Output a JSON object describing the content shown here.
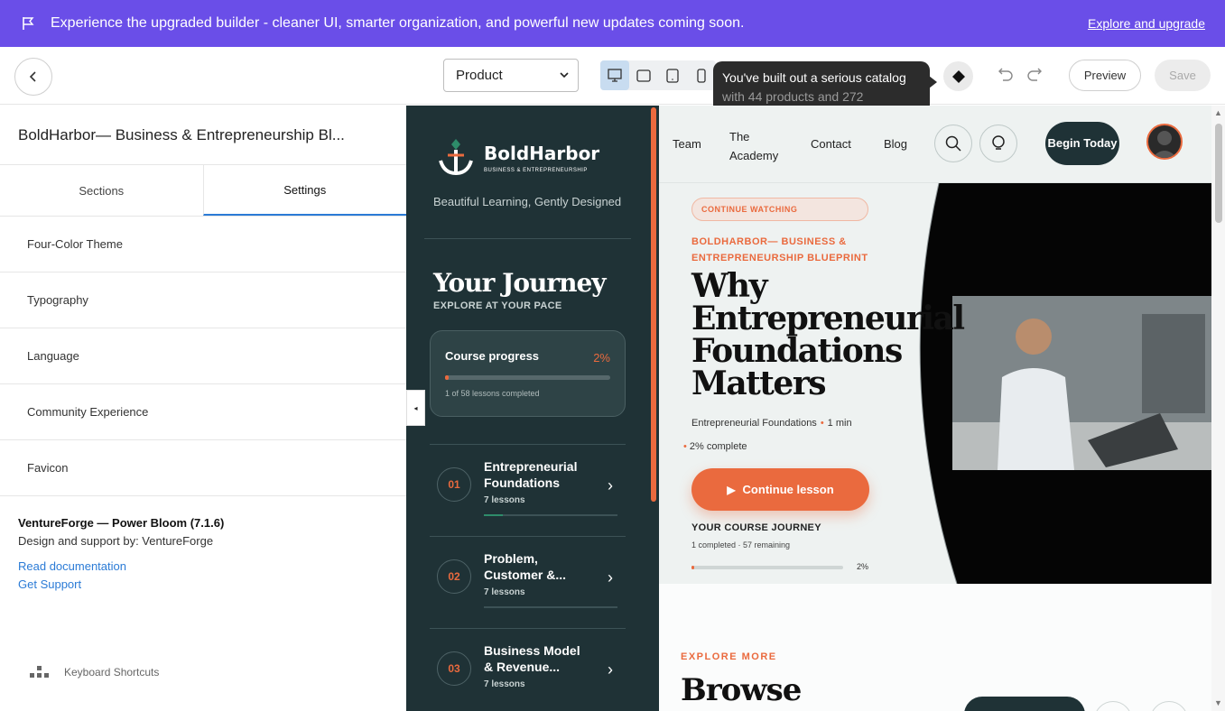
{
  "banner": {
    "message": "Experience the upgraded builder - cleaner UI, smarter organization, and powerful new updates coming soon.",
    "link": "Explore and upgrade",
    "color": "#6a4ee8"
  },
  "toolbar": {
    "page_select": "Product",
    "devices": [
      "desktop-icon",
      "tablet-landscape-icon",
      "tablet-portrait-icon",
      "mobile-icon"
    ],
    "tooltip_line1": "You've built out a serious catalog",
    "tooltip_line2": "with 44 products and 272",
    "preview_label": "Preview",
    "save_label": "Save"
  },
  "sidebar": {
    "site_title": "BoldHarbor— Business & Entrepreneurship Bl...",
    "tabs": [
      {
        "label": "Sections"
      },
      {
        "label": "Settings"
      }
    ],
    "settings": [
      {
        "label": "Four-Color Theme"
      },
      {
        "label": "Typography"
      },
      {
        "label": "Language"
      },
      {
        "label": "Community Experience"
      },
      {
        "label": "Favicon"
      }
    ],
    "theme_name": "VentureForge — Power Bloom (7.1.6)",
    "theme_by": "Design and support by: VentureForge",
    "doc_link": "Read documentation",
    "support_link": "Get Support",
    "shortcuts_label": "Keyboard Shortcuts"
  },
  "course": {
    "brand_name": "BoldHarbor",
    "brand_sub": "BUSINESS & ENTREPRENEURSHIP",
    "tagline": "Beautiful Learning, Gently Designed",
    "journey_title": "Your Journey",
    "journey_sub": "EXPLORE AT YOUR PACE",
    "progress_label": "Course progress",
    "progress_pct_text": "2%",
    "progress_value": 0.02,
    "progress_sub": "1 of 58 lessons completed",
    "modules": [
      {
        "num": "01",
        "title": "Entrepreneurial Foundations",
        "lessons": "7 lessons",
        "progress": 0.14
      },
      {
        "num": "02",
        "title": "Problem, Customer &...",
        "lessons": "7 lessons",
        "progress": 0
      },
      {
        "num": "03",
        "title": "Business Model & Revenue...",
        "lessons": "7 lessons",
        "progress": 0
      }
    ]
  },
  "site": {
    "nav": {
      "team": "Team",
      "academy": "The Academy",
      "contact": "Contact",
      "blog": "Blog",
      "begin": "Begin Today"
    },
    "pill": "CONTINUE WATCHING",
    "eyebrow": "BOLDHARBOR— BUSINESS & ENTREPRENEURSHIP BLUEPRINT",
    "headline": "Why Entrepreneurial Foundations Matters",
    "meta_module": "Entrepreneurial Foundations",
    "meta_time": "1 min",
    "meta_complete": "2% complete",
    "cta": "Continue lesson",
    "journey_label": "YOUR COURSE JOURNEY",
    "journey_sub": "1 completed · 57 remaining",
    "journey_pct_text": "2%",
    "journey_value": 0.02,
    "explore_label": "EXPLORE MORE",
    "browse": "Browse"
  },
  "colors": {
    "accent": "#ea6a3e",
    "dark": "#1f3236",
    "link": "#2b7bd6"
  }
}
